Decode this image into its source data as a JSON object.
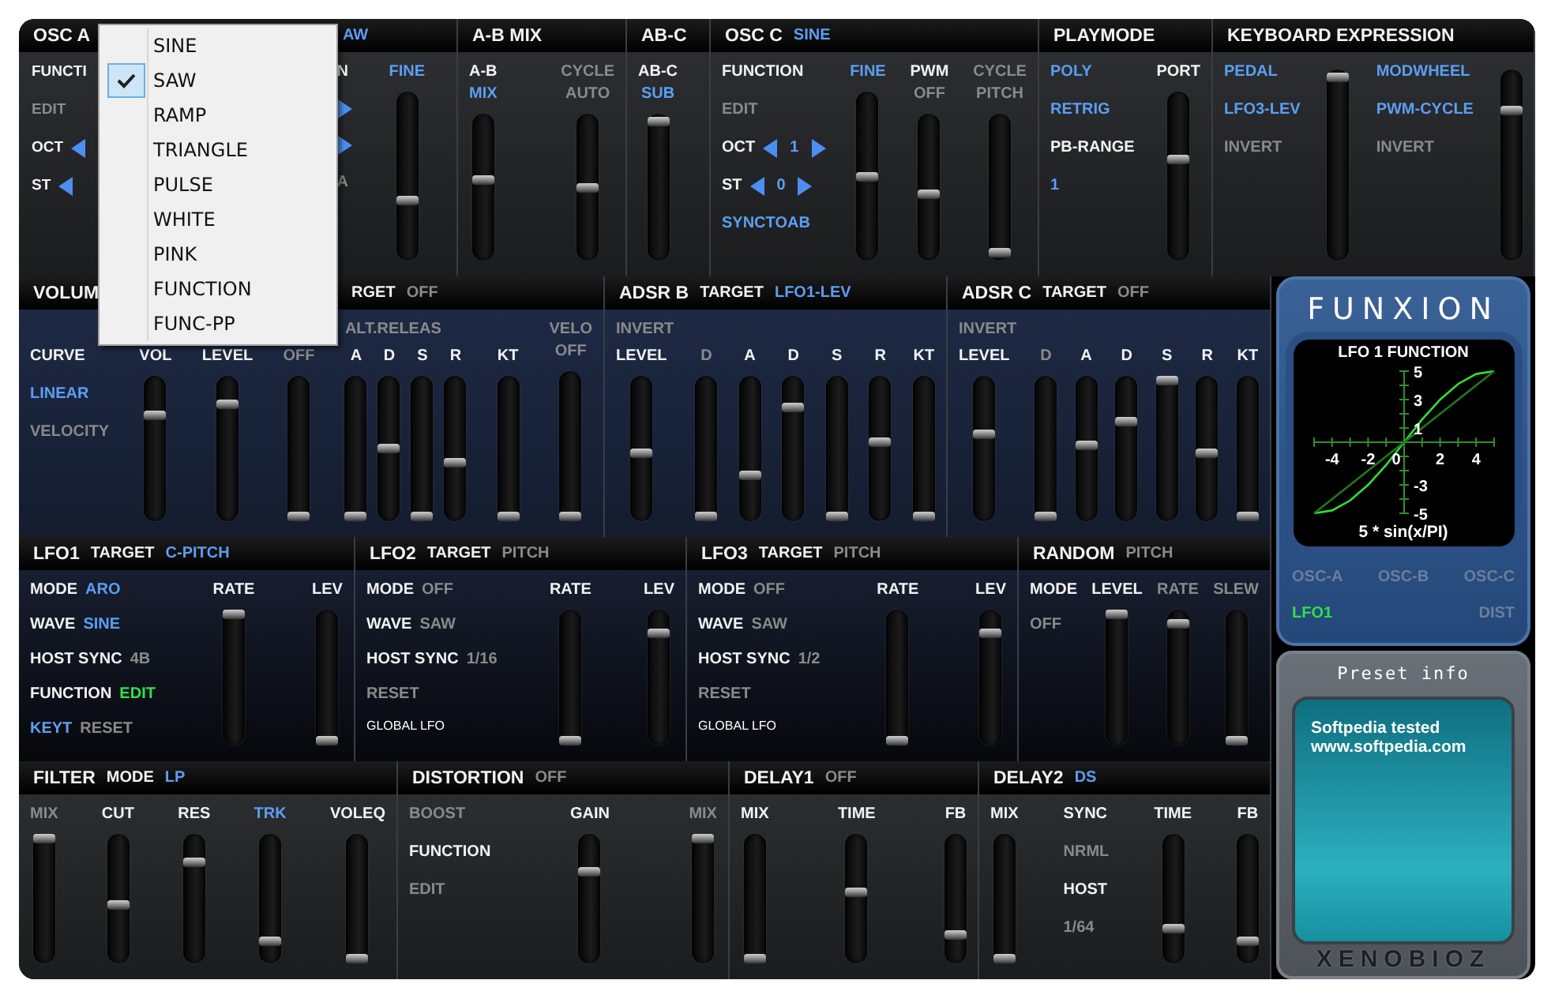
{
  "top": [
    {
      "kind": "osc_pair",
      "header": [
        {
          "text": "OSC A",
          "kind": "label"
        },
        {
          "text": "AW",
          "kind": "value"
        }
      ],
      "columns": [
        {
          "kind": "stack",
          "items": [
            {
              "kind": "line",
              "parts": [
                {
                  "text": "FUNCTI",
                  "kind": "label"
                }
              ]
            },
            {
              "kind": "line",
              "parts": [
                {
                  "text": "EDIT",
                  "kind": "inactive"
                }
              ]
            },
            {
              "kind": "stepper_left",
              "label": "OCT"
            },
            {
              "kind": "stepper_left",
              "label": "ST"
            }
          ]
        },
        {
          "kind": "stack",
          "items": [
            {
              "kind": "line",
              "parts": [
                {
                  "text": "N",
                  "kind": "label"
                }
              ]
            },
            {
              "kind": "arrow_right"
            },
            {
              "kind": "arrow_right"
            },
            {
              "kind": "line",
              "parts": [
                {
                  "text": "A",
                  "kind": "inactive"
                }
              ]
            }
          ]
        },
        {
          "kind": "slider",
          "labels": [
            {
              "text": "FINE",
              "kind": "value"
            }
          ],
          "level": 0.35
        }
      ]
    },
    {
      "kind": "plain",
      "header": [
        {
          "text": "A-B MIX",
          "kind": "label"
        }
      ],
      "columns": [
        {
          "kind": "slider",
          "labels": [
            {
              "text": "A-B",
              "kind": "label"
            },
            {
              "text": "MIX",
              "kind": "value"
            }
          ],
          "level": 0.55
        },
        {
          "kind": "slider",
          "labels": [
            {
              "text": "CYCLE",
              "kind": "inactive"
            },
            {
              "text": "AUTO",
              "kind": "inactive"
            }
          ],
          "level": 0.5
        }
      ]
    },
    {
      "kind": "plain",
      "header": [
        {
          "text": "AB-C",
          "kind": "label"
        }
      ],
      "columns": [
        {
          "kind": "slider",
          "labels": [
            {
              "text": "AB-C",
              "kind": "label"
            },
            {
              "text": "SUB",
              "kind": "value"
            }
          ],
          "level": 0.98
        }
      ]
    },
    {
      "kind": "plain",
      "header": [
        {
          "text": "OSC C",
          "kind": "label"
        },
        {
          "text": "SINE",
          "kind": "value"
        }
      ],
      "columns": [
        {
          "kind": "stack",
          "items": [
            {
              "kind": "line",
              "parts": [
                {
                  "text": "FUNCTION",
                  "kind": "label"
                }
              ]
            },
            {
              "kind": "line",
              "parts": [
                {
                  "text": "EDIT",
                  "kind": "inactive"
                }
              ]
            },
            {
              "kind": "stepper",
              "label": "OCT",
              "value": "1"
            },
            {
              "kind": "stepper",
              "label": "ST",
              "value": "0"
            },
            {
              "kind": "line",
              "parts": [
                {
                  "text": "SYNCTOAB",
                  "kind": "value"
                }
              ]
            }
          ]
        },
        {
          "kind": "slider",
          "labels": [
            {
              "text": "FINE",
              "kind": "value"
            }
          ],
          "level": 0.5
        },
        {
          "kind": "slider",
          "labels": [
            {
              "text": "PWM",
              "kind": "label"
            },
            {
              "text": "OFF",
              "kind": "inactive"
            }
          ],
          "level": 0.45
        },
        {
          "kind": "slider",
          "labels": [
            {
              "text": "CYCLE",
              "kind": "inactive"
            },
            {
              "text": "PITCH",
              "kind": "inactive"
            }
          ],
          "level": 0.02
        }
      ]
    },
    {
      "kind": "plain",
      "header": [
        {
          "text": "PLAYMODE",
          "kind": "label"
        }
      ],
      "columns": [
        {
          "kind": "stack",
          "items": [
            {
              "kind": "line",
              "parts": [
                {
                  "text": "POLY",
                  "kind": "value"
                }
              ]
            },
            {
              "kind": "line",
              "parts": [
                {
                  "text": "RETRIG",
                  "kind": "value"
                }
              ]
            },
            {
              "kind": "line",
              "parts": [
                {
                  "text": "PB-RANGE",
                  "kind": "label"
                }
              ]
            },
            {
              "kind": "line",
              "parts": [
                {
                  "text": "1",
                  "kind": "value"
                }
              ]
            }
          ]
        },
        {
          "kind": "slider",
          "labels": [
            {
              "text": "PORT",
              "kind": "label"
            }
          ],
          "level": 0.6
        }
      ]
    },
    {
      "kind": "plain",
      "header": [
        {
          "text": "KEYBOARD EXPRESSION",
          "kind": "label"
        }
      ],
      "columns": [
        {
          "kind": "stack",
          "items": [
            {
              "kind": "line",
              "parts": [
                {
                  "text": "PEDAL",
                  "kind": "value"
                }
              ]
            },
            {
              "kind": "line",
              "parts": [
                {
                  "text": "LFO3-LEV",
                  "kind": "value"
                }
              ]
            },
            {
              "kind": "line",
              "parts": [
                {
                  "text": "INVERT",
                  "kind": "inactive"
                }
              ]
            }
          ]
        },
        {
          "kind": "slider",
          "level": 0.98
        },
        {
          "kind": "stack",
          "items": [
            {
              "kind": "line",
              "parts": [
                {
                  "text": "MODWHEEL",
                  "kind": "value"
                }
              ]
            },
            {
              "kind": "line",
              "parts": [
                {
                  "text": "PWM-CYCLE",
                  "kind": "value"
                }
              ]
            },
            {
              "kind": "line",
              "parts": [
                {
                  "text": "INVERT",
                  "kind": "inactive"
                }
              ]
            }
          ]
        },
        {
          "kind": "slider",
          "level": 0.8
        }
      ]
    }
  ],
  "middle": [
    {
      "kind": "covered",
      "header": [
        {
          "text": "VOLUM",
          "kind": "label"
        },
        {
          "text": "RGET",
          "kind": "label"
        },
        {
          "text": "OFF",
          "kind": "inactive"
        }
      ],
      "columns": [
        {
          "kind": "stack",
          "items": [
            {
              "kind": "line",
              "parts": [
                {
                  "text": "CURVE",
                  "kind": "label"
                }
              ]
            },
            {
              "kind": "line",
              "parts": [
                {
                  "text": "LINEAR",
                  "kind": "value"
                }
              ]
            },
            {
              "kind": "line",
              "parts": [
                {
                  "text": "VELOCITY",
                  "kind": "inactive"
                }
              ]
            }
          ]
        },
        {
          "kind": "slider",
          "labels": [
            {
              "text": "VOL",
              "kind": "label"
            }
          ],
          "level": 0.75
        },
        {
          "kind": "slider",
          "labels": [
            {
              "text": "LEVEL",
              "kind": "label"
            }
          ],
          "level": 0.82
        },
        {
          "kind": "slider",
          "labels": [
            {
              "text": "OFF",
              "kind": "inactive"
            }
          ],
          "level": 0
        },
        {
          "kind": "group",
          "title": {
            "text": "ALT.RELEAS",
            "kind": "inactive"
          },
          "columns": [
            {
              "kind": "slider",
              "labels": [
                {
                  "text": "A",
                  "kind": "label"
                }
              ],
              "level": 0
            },
            {
              "kind": "slider",
              "labels": [
                {
                  "text": "D",
                  "kind": "label"
                }
              ],
              "level": 0.5
            },
            {
              "kind": "slider",
              "labels": [
                {
                  "text": "S",
                  "kind": "label"
                }
              ],
              "level": 0
            },
            {
              "kind": "slider",
              "labels": [
                {
                  "text": "R",
                  "kind": "label"
                }
              ],
              "level": 0.4
            }
          ]
        },
        {
          "kind": "slider",
          "labels": [
            {
              "text": "KT",
              "kind": "label"
            }
          ],
          "level": 0
        },
        {
          "kind": "slider",
          "labels": [
            {
              "text": "VELO",
              "kind": "inactive"
            },
            {
              "text": "OFF",
              "kind": "inactive"
            }
          ],
          "level": 0
        }
      ]
    },
    {
      "kind": "plain",
      "header": [
        {
          "text": "ADSR B",
          "kind": "label"
        },
        {
          "text": "TARGET",
          "kind": "label"
        },
        {
          "text": "LFO1-LEV",
          "kind": "value"
        }
      ],
      "columns": [
        {
          "kind": "group",
          "title": {
            "text": "INVERT",
            "kind": "inactive"
          },
          "columns": [
            {
              "kind": "slider",
              "labels": [
                {
                  "text": "LEVEL",
                  "kind": "label"
                }
              ],
              "level": 0.47
            }
          ]
        },
        {
          "kind": "slider",
          "labels": [
            {
              "text": "D",
              "kind": "inactive"
            }
          ],
          "level": 0
        },
        {
          "kind": "slider",
          "labels": [
            {
              "text": "A",
              "kind": "label"
            }
          ],
          "level": 0.3
        },
        {
          "kind": "slider",
          "labels": [
            {
              "text": "D",
              "kind": "label"
            }
          ],
          "level": 0.8
        },
        {
          "kind": "slider",
          "labels": [
            {
              "text": "S",
              "kind": "label"
            }
          ],
          "level": 0
        },
        {
          "kind": "slider",
          "labels": [
            {
              "text": "R",
              "kind": "label"
            }
          ],
          "level": 0.55
        },
        {
          "kind": "slider",
          "labels": [
            {
              "text": "KT",
              "kind": "label"
            }
          ],
          "level": 0
        }
      ]
    },
    {
      "kind": "plain",
      "header": [
        {
          "text": "ADSR C",
          "kind": "label"
        },
        {
          "text": "TARGET",
          "kind": "label"
        },
        {
          "text": "OFF",
          "kind": "inactive"
        }
      ],
      "columns": [
        {
          "kind": "group",
          "title": {
            "text": "INVERT",
            "kind": "inactive"
          },
          "columns": [
            {
              "kind": "slider",
              "labels": [
                {
                  "text": "LEVEL",
                  "kind": "label"
                }
              ],
              "level": 0.6
            }
          ]
        },
        {
          "kind": "slider",
          "labels": [
            {
              "text": "D",
              "kind": "inactive"
            }
          ],
          "level": 0
        },
        {
          "kind": "slider",
          "labels": [
            {
              "text": "A",
              "kind": "label"
            }
          ],
          "level": 0.52
        },
        {
          "kind": "slider",
          "labels": [
            {
              "text": "D",
              "kind": "label"
            }
          ],
          "level": 0.7
        },
        {
          "kind": "slider",
          "labels": [
            {
              "text": "S",
              "kind": "label"
            }
          ],
          "level": 1
        },
        {
          "kind": "slider",
          "labels": [
            {
              "text": "R",
              "kind": "label"
            }
          ],
          "level": 0.47
        },
        {
          "kind": "slider",
          "labels": [
            {
              "text": "KT",
              "kind": "label"
            }
          ],
          "level": 0
        }
      ]
    }
  ],
  "lfo": [
    {
      "kind": "plain",
      "header": [
        {
          "text": "LFO1",
          "kind": "label"
        },
        {
          "text": "TARGET",
          "kind": "label"
        },
        {
          "text": "C-PITCH",
          "kind": "value"
        }
      ],
      "columns": [
        {
          "kind": "stack",
          "items": [
            {
              "kind": "line",
              "parts": [
                {
                  "text": "MODE",
                  "kind": "label"
                },
                {
                  "text": "ARO",
                  "kind": "value"
                }
              ]
            },
            {
              "kind": "line",
              "parts": [
                {
                  "text": "WAVE",
                  "kind": "label"
                },
                {
                  "text": "SINE",
                  "kind": "value"
                }
              ]
            },
            {
              "kind": "line",
              "parts": [
                {
                  "text": "HOST SYNC",
                  "kind": "label"
                },
                {
                  "text": "4B",
                  "kind": "inactive"
                }
              ]
            },
            {
              "kind": "line",
              "parts": [
                {
                  "text": "FUNCTION",
                  "kind": "label"
                },
                {
                  "text": "EDIT",
                  "kind": "active"
                }
              ]
            },
            {
              "kind": "line",
              "parts": [
                {
                  "text": "KEYT",
                  "kind": "value"
                },
                {
                  "text": "RESET",
                  "kind": "inactive"
                }
              ]
            }
          ]
        },
        {
          "kind": "slider",
          "labels": [
            {
              "text": "RATE",
              "kind": "label"
            }
          ],
          "level": 1
        },
        {
          "kind": "slider",
          "labels": [
            {
              "text": "LEV",
              "kind": "label"
            }
          ],
          "level": 0
        }
      ]
    },
    {
      "kind": "plain",
      "header": [
        {
          "text": "LFO2",
          "kind": "label"
        },
        {
          "text": "TARGET",
          "kind": "label"
        },
        {
          "text": "PITCH",
          "kind": "inactive"
        }
      ],
      "columns": [
        {
          "kind": "stack",
          "items": [
            {
              "kind": "line",
              "parts": [
                {
                  "text": "MODE",
                  "kind": "label"
                },
                {
                  "text": "OFF",
                  "kind": "inactive"
                }
              ]
            },
            {
              "kind": "line",
              "parts": [
                {
                  "text": "WAVE",
                  "kind": "label"
                },
                {
                  "text": "SAW",
                  "kind": "inactive"
                }
              ]
            },
            {
              "kind": "line",
              "parts": [
                {
                  "text": "HOST SYNC",
                  "kind": "label"
                },
                {
                  "text": "1/16",
                  "kind": "inactive"
                }
              ]
            },
            {
              "kind": "line",
              "parts": [
                {
                  "text": "RESET",
                  "kind": "inactive"
                }
              ]
            },
            {
              "kind": "small",
              "text": "GLOBAL LFO"
            }
          ]
        },
        {
          "kind": "slider",
          "labels": [
            {
              "text": "RATE",
              "kind": "label"
            }
          ],
          "level": 0
        },
        {
          "kind": "slider",
          "labels": [
            {
              "text": "LEV",
              "kind": "label"
            }
          ],
          "level": 0.85
        }
      ]
    },
    {
      "kind": "plain",
      "header": [
        {
          "text": "LFO3",
          "kind": "label"
        },
        {
          "text": "TARGET",
          "kind": "label"
        },
        {
          "text": "PITCH",
          "kind": "inactive"
        }
      ],
      "columns": [
        {
          "kind": "stack",
          "items": [
            {
              "kind": "line",
              "parts": [
                {
                  "text": "MODE",
                  "kind": "label"
                },
                {
                  "text": "OFF",
                  "kind": "inactive"
                }
              ]
            },
            {
              "kind": "line",
              "parts": [
                {
                  "text": "WAVE",
                  "kind": "label"
                },
                {
                  "text": "SAW",
                  "kind": "inactive"
                }
              ]
            },
            {
              "kind": "line",
              "parts": [
                {
                  "text": "HOST SYNC",
                  "kind": "label"
                },
                {
                  "text": "1/2",
                  "kind": "inactive"
                }
              ]
            },
            {
              "kind": "line",
              "parts": [
                {
                  "text": "RESET",
                  "kind": "inactive"
                }
              ]
            },
            {
              "kind": "small",
              "text": "GLOBAL LFO"
            }
          ]
        },
        {
          "kind": "slider",
          "labels": [
            {
              "text": "RATE",
              "kind": "label"
            }
          ],
          "level": 0
        },
        {
          "kind": "slider",
          "labels": [
            {
              "text": "LEV",
              "kind": "label"
            }
          ],
          "level": 0.85
        }
      ]
    },
    {
      "kind": "plain",
      "header": [
        {
          "text": "RANDOM",
          "kind": "label"
        },
        {
          "text": "PITCH",
          "kind": "inactive"
        }
      ],
      "columns": [
        {
          "kind": "stack",
          "items": [
            {
              "kind": "line",
              "parts": [
                {
                  "text": "MODE",
                  "kind": "label"
                }
              ]
            },
            {
              "kind": "line",
              "parts": [
                {
                  "text": "OFF",
                  "kind": "inactive"
                }
              ]
            }
          ]
        },
        {
          "kind": "slider",
          "labels": [
            {
              "text": "LEVEL",
              "kind": "label"
            }
          ],
          "level": 1
        },
        {
          "kind": "slider",
          "labels": [
            {
              "text": "RATE",
              "kind": "inactive"
            }
          ],
          "level": 0.93
        },
        {
          "kind": "slider",
          "labels": [
            {
              "text": "SLEW",
              "kind": "inactive"
            }
          ],
          "level": 0
        }
      ]
    }
  ],
  "effects": [
    {
      "kind": "plain",
      "header": [
        {
          "text": "FILTER",
          "kind": "label"
        },
        {
          "text": "MODE",
          "kind": "label"
        },
        {
          "text": "LP",
          "kind": "value"
        }
      ],
      "columns": [
        {
          "kind": "slider",
          "labels": [
            {
              "text": "MIX",
              "kind": "inactive"
            }
          ],
          "level": 1
        },
        {
          "kind": "slider",
          "labels": [
            {
              "text": "CUT",
              "kind": "label"
            }
          ],
          "level": 0.45
        },
        {
          "kind": "slider",
          "labels": [
            {
              "text": "RES",
              "kind": "label"
            }
          ],
          "level": 0.8
        },
        {
          "kind": "slider",
          "labels": [
            {
              "text": "TRK",
              "kind": "value"
            }
          ],
          "level": 0.15
        },
        {
          "kind": "slider",
          "labels": [
            {
              "text": "VOLEQ",
              "kind": "label"
            }
          ],
          "level": 0
        }
      ]
    },
    {
      "kind": "plain",
      "header": [
        {
          "text": "DISTORTION",
          "kind": "label"
        },
        {
          "text": "OFF",
          "kind": "inactive"
        }
      ],
      "columns": [
        {
          "kind": "stack",
          "items": [
            {
              "kind": "line",
              "parts": [
                {
                  "text": "BOOST",
                  "kind": "inactive"
                }
              ]
            },
            {
              "kind": "line",
              "parts": [
                {
                  "text": "FUNCTION",
                  "kind": "label"
                }
              ]
            },
            {
              "kind": "line",
              "parts": [
                {
                  "text": "EDIT",
                  "kind": "inactive"
                }
              ]
            }
          ]
        },
        {
          "kind": "slider",
          "labels": [
            {
              "text": "GAIN",
              "kind": "label"
            }
          ],
          "level": 0.72
        },
        {
          "kind": "slider",
          "labels": [
            {
              "text": "MIX",
              "kind": "inactive"
            }
          ],
          "level": 1
        }
      ]
    },
    {
      "kind": "plain",
      "header": [
        {
          "text": "DELAY1",
          "kind": "label"
        },
        {
          "text": "OFF",
          "kind": "inactive"
        }
      ],
      "columns": [
        {
          "kind": "slider",
          "labels": [
            {
              "text": "MIX",
              "kind": "label"
            }
          ],
          "level": 0
        },
        {
          "kind": "slider",
          "labels": [
            {
              "text": "TIME",
              "kind": "label"
            }
          ],
          "level": 0.55
        },
        {
          "kind": "slider",
          "labels": [
            {
              "text": "FB",
              "kind": "label"
            }
          ],
          "level": 0.2
        }
      ]
    },
    {
      "kind": "plain",
      "header": [
        {
          "text": "DELAY2",
          "kind": "label"
        },
        {
          "text": "DS",
          "kind": "value"
        }
      ],
      "columns": [
        {
          "kind": "slider",
          "labels": [
            {
              "text": "MIX",
              "kind": "label"
            }
          ],
          "level": 0
        },
        {
          "kind": "stack",
          "items": [
            {
              "kind": "line",
              "parts": [
                {
                  "text": "SYNC",
                  "kind": "label"
                }
              ]
            },
            {
              "kind": "line",
              "parts": [
                {
                  "text": "NRML",
                  "kind": "inactive"
                }
              ]
            },
            {
              "kind": "line",
              "parts": [
                {
                  "text": "HOST",
                  "kind": "label"
                }
              ]
            },
            {
              "kind": "line",
              "parts": [
                {
                  "text": "1/64",
                  "kind": "inactive"
                }
              ]
            }
          ]
        },
        {
          "kind": "slider",
          "labels": [
            {
              "text": "TIME",
              "kind": "label"
            }
          ],
          "level": 0.25
        },
        {
          "kind": "slider",
          "labels": [
            {
              "text": "FB",
              "kind": "label"
            }
          ],
          "level": 0.15
        }
      ]
    }
  ],
  "funxion": {
    "logo": "FUNXION",
    "formula": "5 * sin(x/PI)",
    "chart_data": {
      "type": "line",
      "title": "LFO 1 FUNCTION",
      "x": [
        -5,
        -4,
        -3,
        -2,
        -1,
        0,
        1,
        2,
        3,
        4,
        5
      ],
      "xlim": [
        -5,
        5
      ],
      "ylim": [
        -5,
        5
      ],
      "xticks": [
        -4,
        -2,
        0,
        2,
        4
      ],
      "yticks": [
        5,
        3,
        1,
        -3,
        -5
      ],
      "series": [
        {
          "color": "#33e033",
          "values": [
            -5,
            -4.8,
            -4.1,
            -3,
            -1.6,
            0,
            1.6,
            3,
            4.1,
            4.8,
            5
          ]
        },
        {
          "color": "#1e7a1e",
          "values": [
            -5,
            -4,
            -3,
            -2,
            -1,
            0,
            1,
            2,
            3,
            4,
            5
          ]
        }
      ]
    },
    "targets": [
      {
        "text": "OSC-A",
        "selected": false
      },
      {
        "text": "OSC-B",
        "selected": false
      },
      {
        "text": "OSC-C",
        "selected": false
      },
      {
        "text": "LFO1",
        "selected": true
      },
      {
        "text": "DIST",
        "selected": false
      }
    ]
  },
  "preset_info": {
    "title": "Preset info",
    "lines": [
      "Softpedia tested",
      "www.softpedia.com"
    ],
    "footer": "XENOBIOZ"
  },
  "waveform_menu": {
    "items": [
      {
        "text": "SINE",
        "selected": false
      },
      {
        "text": "SAW",
        "selected": true
      },
      {
        "text": "RAMP",
        "selected": false
      },
      {
        "text": "TRIANGLE",
        "selected": false
      },
      {
        "text": "PULSE",
        "selected": false
      },
      {
        "text": "WHITE",
        "selected": false
      },
      {
        "text": "PINK",
        "selected": false
      },
      {
        "text": "FUNCTION",
        "selected": false
      },
      {
        "text": "FUNC-PP",
        "selected": false
      }
    ]
  }
}
